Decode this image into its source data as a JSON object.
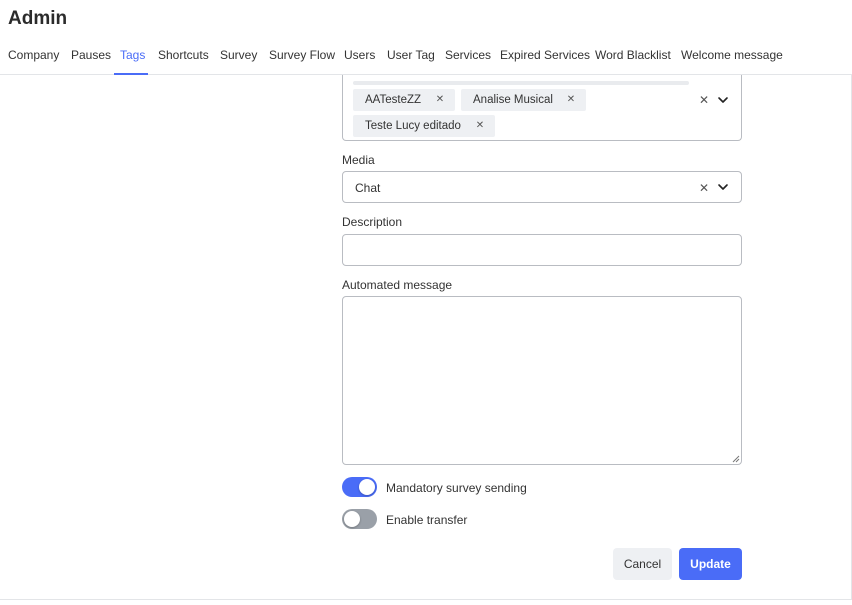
{
  "page": {
    "title": "Admin"
  },
  "tabs": [
    {
      "label": "Company"
    },
    {
      "label": "Pauses"
    },
    {
      "label": "Tags",
      "active": true
    },
    {
      "label": "Shortcuts"
    },
    {
      "label": "Survey"
    },
    {
      "label": "Survey Flow"
    },
    {
      "label": "Users"
    },
    {
      "label": "User Tag"
    },
    {
      "label": "Services"
    },
    {
      "label": "Expired Services"
    },
    {
      "label": "Word Blacklist"
    },
    {
      "label": "Welcome message"
    }
  ],
  "form": {
    "selected_items": [
      {
        "label": "AATesteZZ"
      },
      {
        "label": "Analise Musical"
      },
      {
        "label": "Teste Lucy editado"
      }
    ],
    "media": {
      "label": "Media",
      "value": "Chat"
    },
    "description": {
      "label": "Description",
      "value": "",
      "placeholder": ""
    },
    "automated_message": {
      "label": "Automated message",
      "value": ""
    },
    "toggles": [
      {
        "label": "Mandatory survey sending",
        "on": true
      },
      {
        "label": "Enable transfer",
        "on": false
      }
    ],
    "buttons": {
      "cancel": "Cancel",
      "update": "Update"
    }
  },
  "colors": {
    "accent": "#4a6cf7",
    "toggle_off": "#9aa0a8",
    "border": "#b9bcc2"
  },
  "icons": {
    "remove": "close-icon",
    "clear": "clear-icon",
    "dropdown": "chevron-down-icon"
  }
}
